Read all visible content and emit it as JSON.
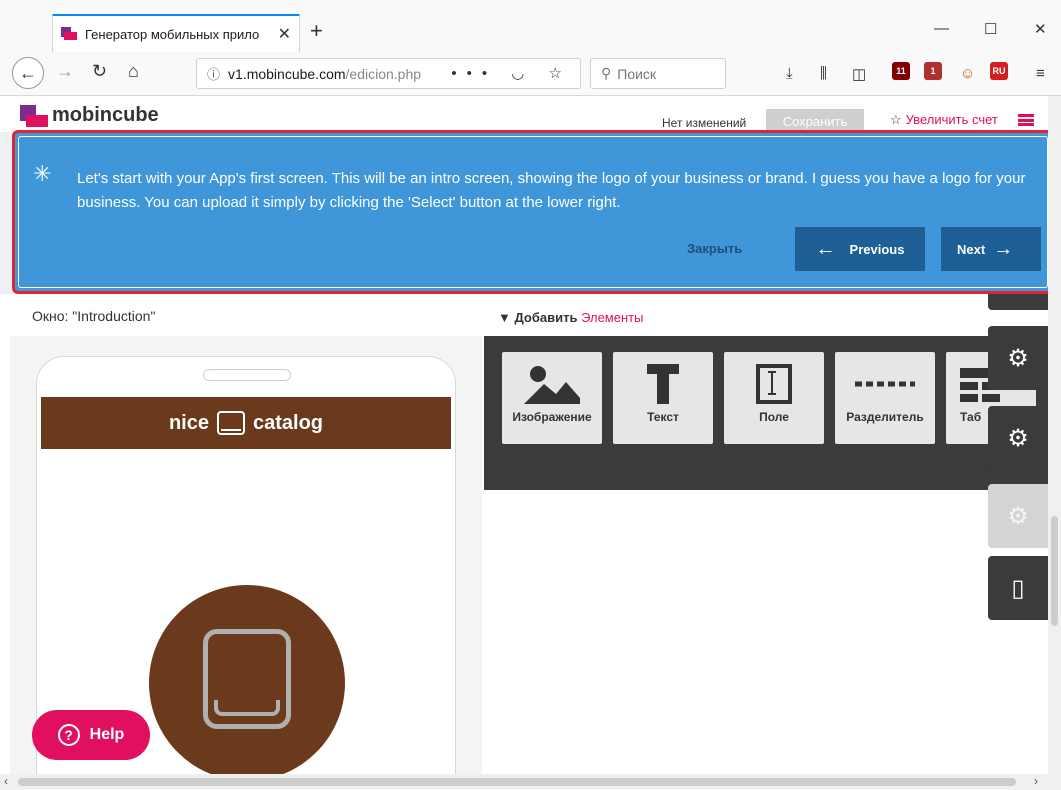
{
  "browser": {
    "tab_title": "Генератор мобильных прило",
    "tab_close": "✕",
    "new_tab": "+",
    "url_host": "v1.mobincube.com",
    "url_path": "/edicion.php",
    "url_more": "•••",
    "search_placeholder": "Поиск",
    "badges": {
      "ublock": "11",
      "ext2": "1",
      "lang": "RU"
    }
  },
  "app": {
    "logo_text": "mobincube",
    "status": "Нет изменений",
    "save_label": "Сохранить",
    "upgrade_label": "Увеличить счет"
  },
  "tour": {
    "text": "Let's start with your App's first screen. This will be an intro screen, showing the logo of your business or brand. I guess you have a logo for your business. You can upload it simply by clicking the 'Select' button at the lower right.",
    "close_label": "Закрыть",
    "previous_label": "Previous",
    "next_label": "Next"
  },
  "editor": {
    "window_label": "Окно: \"Introduction\"",
    "add_label": "▼ Добавить",
    "add_highlight": "Элементы",
    "app_title_left": "nice",
    "app_title_right": "catalog",
    "elements": [
      {
        "label": "Изображение",
        "icon": "image-icon"
      },
      {
        "label": "Текст",
        "icon": "text-icon"
      },
      {
        "label": "Поле",
        "icon": "field-icon"
      },
      {
        "label": "Разделитель",
        "icon": "separator-icon"
      },
      {
        "label": "Таб",
        "icon": "table-icon"
      }
    ],
    "help_label": "Help"
  },
  "colors": {
    "brand_pink": "#e0105f",
    "brand_purple": "#7c2c8a",
    "tour_blue": "#3f97d9",
    "tour_button": "#1e5f96",
    "app_brown": "#6b3a1d",
    "highlight_red": "#e0252f"
  }
}
